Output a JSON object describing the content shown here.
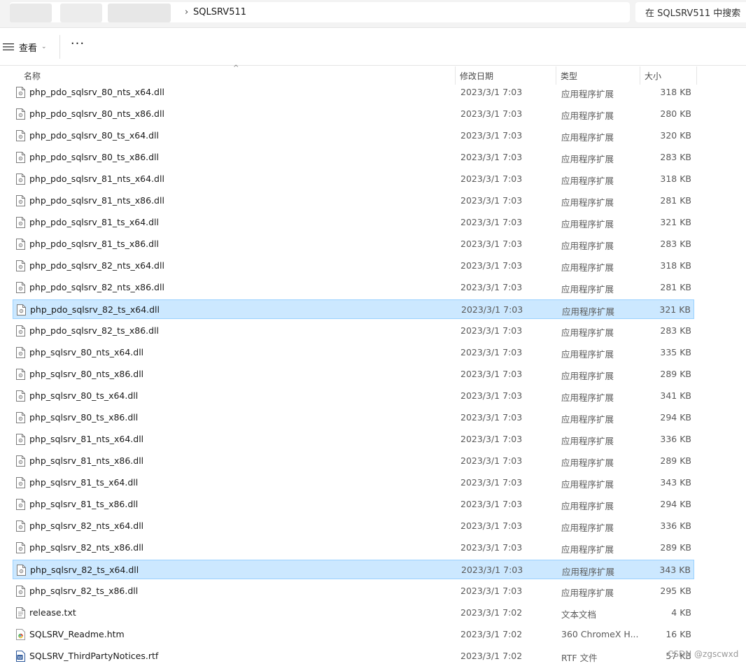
{
  "address_bar": {
    "current_folder": "SQLSRV511",
    "separator": "›",
    "search_placeholder": "在 SQLSRV511 中搜索"
  },
  "toolbar": {
    "view_label": "查看",
    "more_label": "···"
  },
  "columns": {
    "name": "名称",
    "date": "修改日期",
    "type": "类型",
    "size": "大小"
  },
  "files": [
    {
      "name": "php_pdo_sqlsrv_80_nts_x64.dll",
      "date": "2023/3/1 7:03",
      "type": "应用程序扩展",
      "size": "318 KB",
      "icon": "dll-file-icon",
      "selected": false
    },
    {
      "name": "php_pdo_sqlsrv_80_nts_x86.dll",
      "date": "2023/3/1 7:03",
      "type": "应用程序扩展",
      "size": "280 KB",
      "icon": "dll-file-icon",
      "selected": false
    },
    {
      "name": "php_pdo_sqlsrv_80_ts_x64.dll",
      "date": "2023/3/1 7:03",
      "type": "应用程序扩展",
      "size": "320 KB",
      "icon": "dll-file-icon",
      "selected": false
    },
    {
      "name": "php_pdo_sqlsrv_80_ts_x86.dll",
      "date": "2023/3/1 7:03",
      "type": "应用程序扩展",
      "size": "283 KB",
      "icon": "dll-file-icon",
      "selected": false
    },
    {
      "name": "php_pdo_sqlsrv_81_nts_x64.dll",
      "date": "2023/3/1 7:03",
      "type": "应用程序扩展",
      "size": "318 KB",
      "icon": "dll-file-icon",
      "selected": false
    },
    {
      "name": "php_pdo_sqlsrv_81_nts_x86.dll",
      "date": "2023/3/1 7:03",
      "type": "应用程序扩展",
      "size": "281 KB",
      "icon": "dll-file-icon",
      "selected": false
    },
    {
      "name": "php_pdo_sqlsrv_81_ts_x64.dll",
      "date": "2023/3/1 7:03",
      "type": "应用程序扩展",
      "size": "321 KB",
      "icon": "dll-file-icon",
      "selected": false
    },
    {
      "name": "php_pdo_sqlsrv_81_ts_x86.dll",
      "date": "2023/3/1 7:03",
      "type": "应用程序扩展",
      "size": "283 KB",
      "icon": "dll-file-icon",
      "selected": false
    },
    {
      "name": "php_pdo_sqlsrv_82_nts_x64.dll",
      "date": "2023/3/1 7:03",
      "type": "应用程序扩展",
      "size": "318 KB",
      "icon": "dll-file-icon",
      "selected": false
    },
    {
      "name": "php_pdo_sqlsrv_82_nts_x86.dll",
      "date": "2023/3/1 7:03",
      "type": "应用程序扩展",
      "size": "281 KB",
      "icon": "dll-file-icon",
      "selected": false
    },
    {
      "name": "php_pdo_sqlsrv_82_ts_x64.dll",
      "date": "2023/3/1 7:03",
      "type": "应用程序扩展",
      "size": "321 KB",
      "icon": "dll-file-icon",
      "selected": true
    },
    {
      "name": "php_pdo_sqlsrv_82_ts_x86.dll",
      "date": "2023/3/1 7:03",
      "type": "应用程序扩展",
      "size": "283 KB",
      "icon": "dll-file-icon",
      "selected": false
    },
    {
      "name": "php_sqlsrv_80_nts_x64.dll",
      "date": "2023/3/1 7:03",
      "type": "应用程序扩展",
      "size": "335 KB",
      "icon": "dll-file-icon",
      "selected": false
    },
    {
      "name": "php_sqlsrv_80_nts_x86.dll",
      "date": "2023/3/1 7:03",
      "type": "应用程序扩展",
      "size": "289 KB",
      "icon": "dll-file-icon",
      "selected": false
    },
    {
      "name": "php_sqlsrv_80_ts_x64.dll",
      "date": "2023/3/1 7:03",
      "type": "应用程序扩展",
      "size": "341 KB",
      "icon": "dll-file-icon",
      "selected": false
    },
    {
      "name": "php_sqlsrv_80_ts_x86.dll",
      "date": "2023/3/1 7:03",
      "type": "应用程序扩展",
      "size": "294 KB",
      "icon": "dll-file-icon",
      "selected": false
    },
    {
      "name": "php_sqlsrv_81_nts_x64.dll",
      "date": "2023/3/1 7:03",
      "type": "应用程序扩展",
      "size": "336 KB",
      "icon": "dll-file-icon",
      "selected": false
    },
    {
      "name": "php_sqlsrv_81_nts_x86.dll",
      "date": "2023/3/1 7:03",
      "type": "应用程序扩展",
      "size": "289 KB",
      "icon": "dll-file-icon",
      "selected": false
    },
    {
      "name": "php_sqlsrv_81_ts_x64.dll",
      "date": "2023/3/1 7:03",
      "type": "应用程序扩展",
      "size": "343 KB",
      "icon": "dll-file-icon",
      "selected": false
    },
    {
      "name": "php_sqlsrv_81_ts_x86.dll",
      "date": "2023/3/1 7:03",
      "type": "应用程序扩展",
      "size": "294 KB",
      "icon": "dll-file-icon",
      "selected": false
    },
    {
      "name": "php_sqlsrv_82_nts_x64.dll",
      "date": "2023/3/1 7:03",
      "type": "应用程序扩展",
      "size": "336 KB",
      "icon": "dll-file-icon",
      "selected": false
    },
    {
      "name": "php_sqlsrv_82_nts_x86.dll",
      "date": "2023/3/1 7:03",
      "type": "应用程序扩展",
      "size": "289 KB",
      "icon": "dll-file-icon",
      "selected": false
    },
    {
      "name": "php_sqlsrv_82_ts_x64.dll",
      "date": "2023/3/1 7:03",
      "type": "应用程序扩展",
      "size": "343 KB",
      "icon": "dll-file-icon",
      "selected": true
    },
    {
      "name": "php_sqlsrv_82_ts_x86.dll",
      "date": "2023/3/1 7:03",
      "type": "应用程序扩展",
      "size": "295 KB",
      "icon": "dll-file-icon",
      "selected": false
    },
    {
      "name": "release.txt",
      "date": "2023/3/1 7:02",
      "type": "文本文档",
      "size": "4 KB",
      "icon": "text-file-icon",
      "selected": false
    },
    {
      "name": "SQLSRV_Readme.htm",
      "date": "2023/3/1 7:02",
      "type": "360 ChromeX H...",
      "size": "16 KB",
      "icon": "browser-file-icon",
      "selected": false
    },
    {
      "name": "SQLSRV_ThirdPartyNotices.rtf",
      "date": "2023/3/1 7:02",
      "type": "RTF 文件",
      "size": "57 KB",
      "icon": "word-file-icon",
      "selected": false
    }
  ],
  "watermark": "CSDN @zgscwxd",
  "colors": {
    "selection_bg": "#cce8ff",
    "selection_border": "#99d1ff",
    "address_bar_bg": "#f3f3f3"
  }
}
